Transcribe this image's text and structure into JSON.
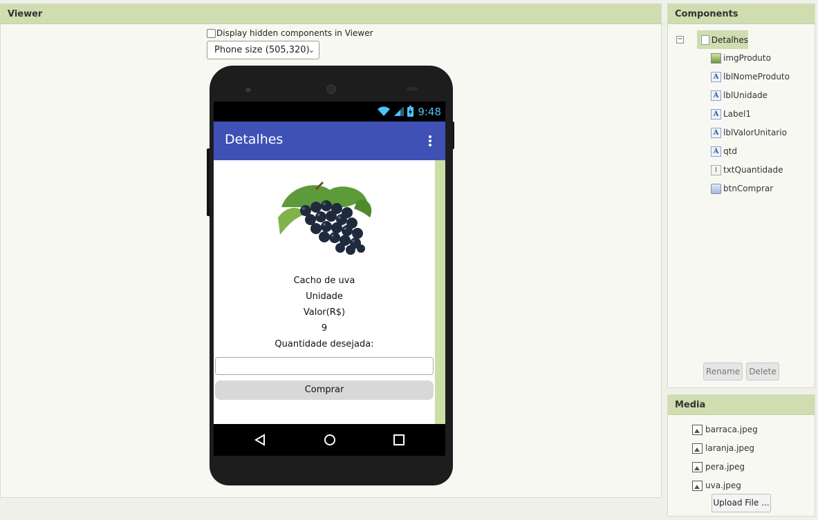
{
  "viewer": {
    "title": "Viewer",
    "hidden_components_label": "Display hidden components in Viewer",
    "size_select": "Phone size (505,320)"
  },
  "phone": {
    "status_time": "9:48",
    "app_title": "Detalhes",
    "labels": {
      "nome_produto": "Cacho de uva",
      "unidade": "Unidade",
      "label1": "Valor(R$)",
      "valor_unitario": "9",
      "qtd": "Quantidade desejada:"
    },
    "button_label": "Comprar",
    "accent": "#3f51b5",
    "scroll_color": "#cddda6"
  },
  "components": {
    "title": "Components",
    "root": "Detalhes",
    "items": [
      {
        "name": "imgProduto",
        "icon": "image-icon"
      },
      {
        "name": "lblNomeProduto",
        "icon": "label-icon"
      },
      {
        "name": "lblUnidade",
        "icon": "label-icon"
      },
      {
        "name": "Label1",
        "icon": "label-icon"
      },
      {
        "name": "lblValorUnitario",
        "icon": "label-icon"
      },
      {
        "name": "qtd",
        "icon": "label-icon"
      },
      {
        "name": "txtQuantidade",
        "icon": "textbox-icon"
      },
      {
        "name": "btnComprar",
        "icon": "button-icon"
      }
    ],
    "rename_label": "Rename",
    "delete_label": "Delete"
  },
  "media": {
    "title": "Media",
    "files": [
      "barraca.jpeg",
      "laranja.jpeg",
      "pera.jpeg",
      "uva.jpeg"
    ],
    "upload_label": "Upload File ..."
  }
}
